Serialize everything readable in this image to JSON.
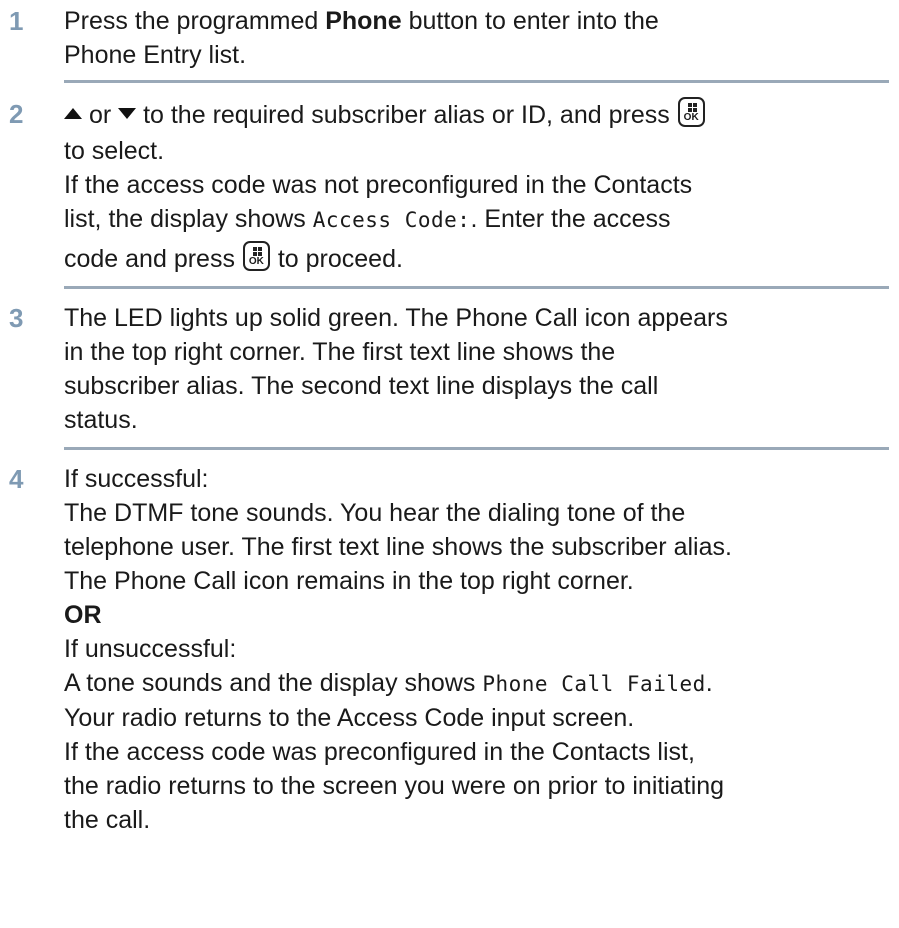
{
  "accent_color": "#7f9ab3",
  "divider_color": "#9aa9b8",
  "steps": [
    {
      "number": "1",
      "l1_pre": "Press the programmed ",
      "l1_bold": "Phone",
      "l1_post": " button to enter into the",
      "l2": "Phone Entry list."
    },
    {
      "number": "2",
      "l1_or": " or ",
      "l1_post": " to the required subscriber alias or ID, and press ",
      "l2": "to select.",
      "l3": "If the access code was not preconfigured in the Contacts",
      "l4_pre": "list, the display shows ",
      "l4_mono": "Access Code:",
      "l4_post": ". Enter the access",
      "l5_pre": "code and press ",
      "l5_post": " to proceed.",
      "ok_label": "OK"
    },
    {
      "number": "3",
      "lines": [
        "The LED lights up solid green. The Phone Call icon appears",
        "in the top right corner. The first text line shows the",
        "subscriber alias. The second text line displays the call",
        "status."
      ]
    },
    {
      "number": "4",
      "l1": "If successful:",
      "l2": "The DTMF tone sounds. You hear the dialing tone of the",
      "l3": "telephone user. The first text line shows the subscriber alias.",
      "l4": "The Phone Call icon remains in the top right corner.",
      "l5": "OR",
      "l6": "If unsuccessful:",
      "l7_pre": "A tone sounds and the display shows ",
      "l7_mono": "Phone Call Failed",
      "l7_post": ".",
      "l8": "Your radio returns to the Access Code input screen.",
      "l9": "If the access code was preconfigured in the Contacts list,",
      "l10": "the radio returns to the screen you were on prior to initiating",
      "l11": "the call."
    }
  ]
}
